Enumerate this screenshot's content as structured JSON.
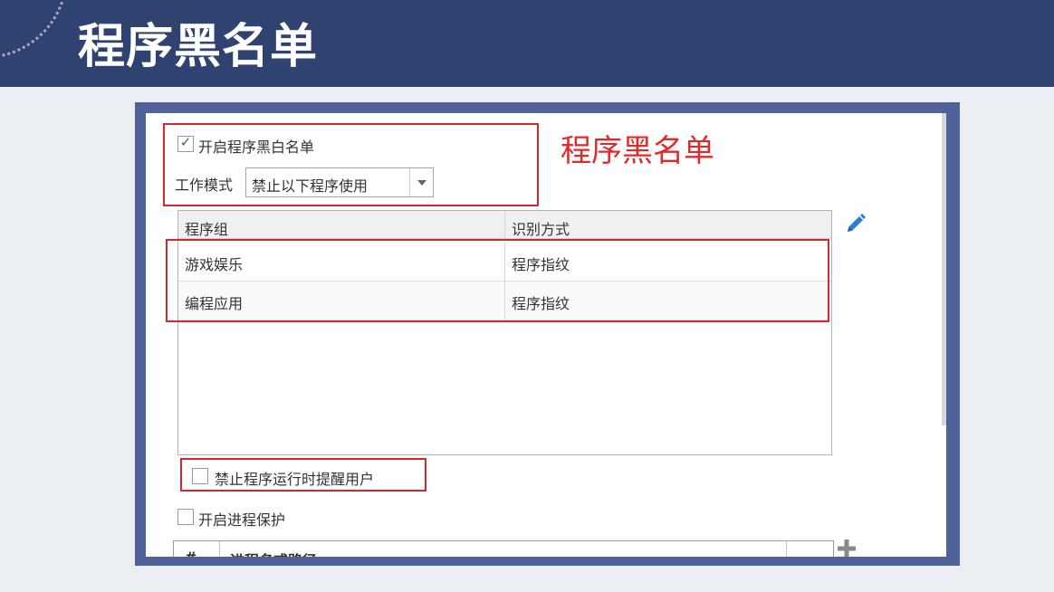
{
  "slide": {
    "title": "程序黑名单"
  },
  "annotation": {
    "text": "程序黑名单"
  },
  "settings": {
    "enable_list_label": "开启程序黑白名单",
    "enable_list_checked": true,
    "work_mode_label": "工作模式",
    "work_mode_value": "禁止以下程序使用",
    "remind_user_label": "禁止程序运行时提醒用户",
    "remind_user_checked": false,
    "process_protect_label": "开启进程保护",
    "process_protect_checked": false
  },
  "program_table": {
    "columns": [
      "程序组",
      "识别方式"
    ],
    "rows": [
      [
        "游戏娱乐",
        "程序指纹"
      ],
      [
        "编程应用",
        "程序指纹"
      ]
    ]
  },
  "process_table": {
    "columns": [
      "#",
      "进程名或路径"
    ]
  },
  "icons": {
    "edit": "pencil-icon",
    "add": "plus-icon",
    "check": "check-icon",
    "dropdown": "chevron-down-icon"
  },
  "colors": {
    "banner": "#304370",
    "frame": "#51629a",
    "annotation_red": "#e02a2a",
    "accent_blue": "#2a7fd4"
  }
}
